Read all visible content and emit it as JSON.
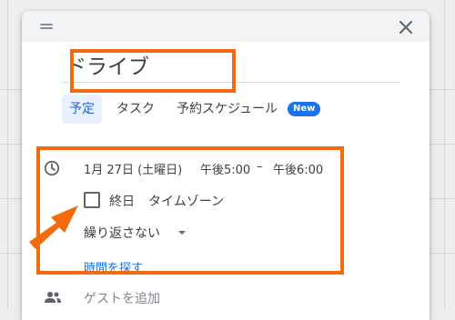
{
  "dialog": {
    "drag_icon": "drag-handle-icon",
    "close_icon": "close-icon",
    "title": "ドライブ"
  },
  "tabs": [
    {
      "label": "予定",
      "active": true
    },
    {
      "label": "タスク",
      "active": false
    },
    {
      "label": "予約スケジュール",
      "active": false
    }
  ],
  "new_badge": "New",
  "datetime": {
    "icon": "clock-icon",
    "date": "1月 27日 (土曜日)",
    "start": "午後5:00",
    "separator": "–",
    "end": "午後6:00"
  },
  "all_day": {
    "label": "終日",
    "checked": false
  },
  "timezone_label": "タイムゾーン",
  "repeat": {
    "selected": "繰り返さない"
  },
  "find_time_label": "時間を探す",
  "guests": {
    "icon": "people-icon",
    "placeholder": "ゲストを追加"
  },
  "colors": {
    "highlight": "#f36b0c",
    "accent": "#1a73e8",
    "active_tab_bg": "#e8f0fe"
  }
}
